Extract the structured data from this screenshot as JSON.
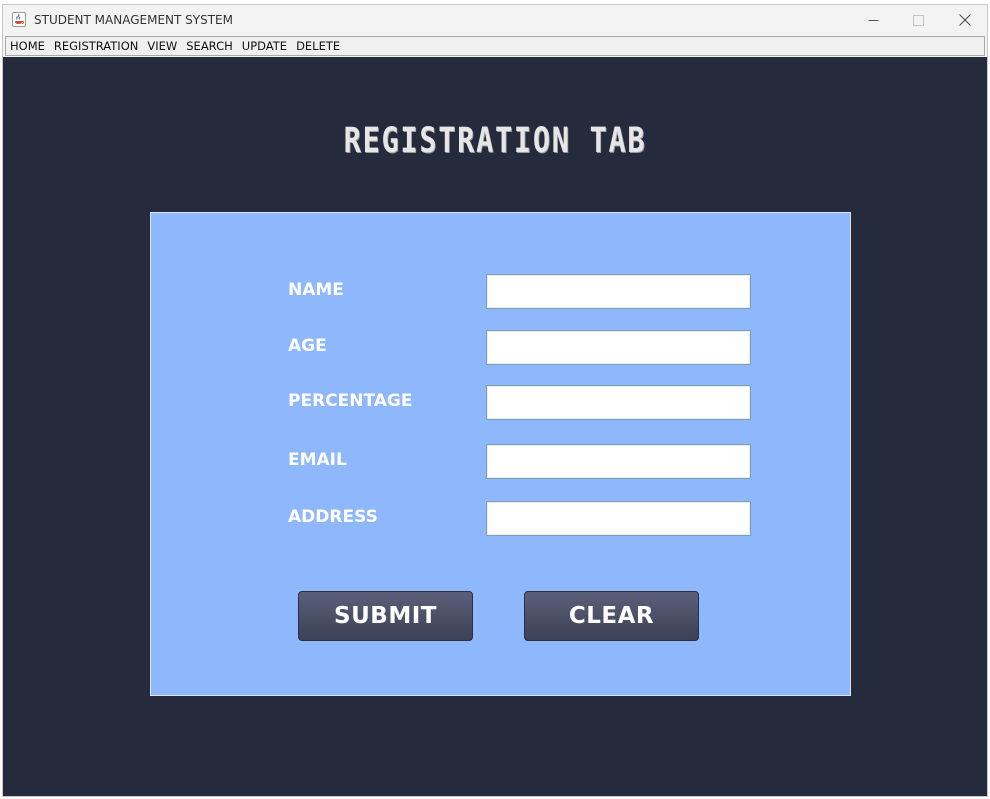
{
  "window": {
    "title": "STUDENT MANAGEMENT SYSTEM",
    "icon": "java-cup-icon"
  },
  "menu": {
    "items": [
      "HOME",
      "REGISTRATION",
      "VIEW",
      "SEARCH",
      "UPDATE",
      "DELETE"
    ]
  },
  "page": {
    "heading": "REGISTRATION TAB"
  },
  "form": {
    "fields": [
      {
        "label": "NAME",
        "value": ""
      },
      {
        "label": "AGE",
        "value": ""
      },
      {
        "label": "PERCENTAGE",
        "value": ""
      },
      {
        "label": "EMAIL",
        "value": ""
      },
      {
        "label": "ADDRESS",
        "value": ""
      }
    ],
    "submit_label": "SUBMIT",
    "clear_label": "CLEAR"
  },
  "colors": {
    "background": "#252a3d",
    "panel": "#8eb8fb",
    "button": "#464b63",
    "label_text": "#ffffff"
  }
}
